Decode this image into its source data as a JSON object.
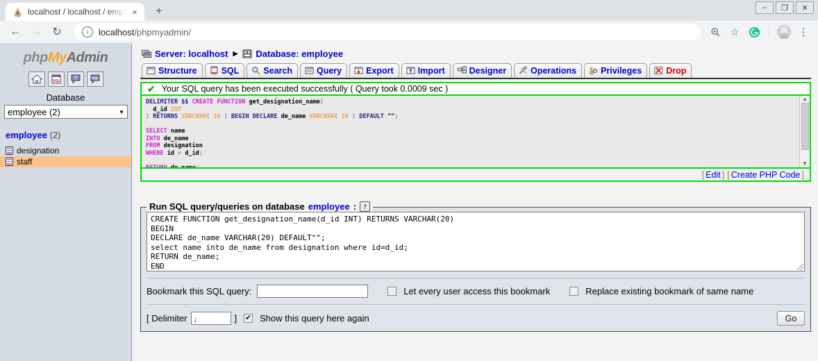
{
  "browser": {
    "tab": {
      "title": "localhost / localhost / employee |",
      "favicon": "phpmyadmin-favicon",
      "close": "×"
    },
    "newtab_label": "+",
    "window_controls": {
      "minimize": "–",
      "restore": "❐",
      "close": "✕"
    },
    "nav": {
      "back": "←",
      "forward": "→",
      "reload": "↻"
    },
    "omnibox": {
      "info": "i",
      "host": "localhost",
      "path": "/phpmyadmin/"
    },
    "toolbar_icons": {
      "zoom": "⌕",
      "bookmark": "☆",
      "grammarly": "G",
      "menu": "⋮"
    }
  },
  "sidebar": {
    "logo": {
      "php": "php",
      "my": "My",
      "admin": "Admin"
    },
    "quick_icons": [
      {
        "name": "home-icon",
        "glyph": "⌂"
      },
      {
        "name": "sql-doc-icon",
        "glyph": "SQL"
      },
      {
        "name": "help-bubble-icon",
        "glyph": "?"
      },
      {
        "name": "sql-bubble-icon",
        "glyph": "SQL"
      }
    ],
    "database_label": "Database",
    "database_select": {
      "value": "employee (2)",
      "arrow": "▼"
    },
    "db_heading": {
      "name": "employee",
      "count": "(2)"
    },
    "tables": [
      {
        "name": "designation",
        "selected": false
      },
      {
        "name": "staff",
        "selected": true
      }
    ]
  },
  "main": {
    "breadcrumb": {
      "server": "Server: localhost",
      "separator": "▶",
      "database": "Database: employee"
    },
    "tabs": [
      {
        "label": "Structure",
        "icon": "structure-icon"
      },
      {
        "label": "SQL",
        "icon": "sql-icon"
      },
      {
        "label": "Search",
        "icon": "search-icon"
      },
      {
        "label": "Query",
        "icon": "query-icon"
      },
      {
        "label": "Export",
        "icon": "export-icon"
      },
      {
        "label": "Import",
        "icon": "import-icon"
      },
      {
        "label": "Designer",
        "icon": "designer-icon"
      },
      {
        "label": "Operations",
        "icon": "operations-icon"
      },
      {
        "label": "Privileges",
        "icon": "privileges-icon"
      },
      {
        "label": "Drop",
        "icon": "drop-icon"
      }
    ],
    "success": {
      "check": "✔",
      "message": "Your SQL query has been executed successfully ( Query took 0.0009 sec )"
    },
    "code_preview": {
      "lines": [
        [
          [
            "DELIMITER",
            "kw"
          ],
          [
            " ",
            "id"
          ],
          [
            "$$",
            "kw"
          ],
          [
            " ",
            "id"
          ],
          [
            "CREATE FUNCTION",
            "fn"
          ],
          [
            " ",
            "id"
          ],
          [
            "get_designation_name",
            "id"
          ],
          [
            "(",
            "pn"
          ]
        ],
        [
          [
            "  ",
            "id"
          ],
          [
            "d_id",
            "id"
          ],
          [
            " ",
            "id"
          ],
          [
            "INT",
            "ty"
          ]
        ],
        [
          [
            ")",
            "pn"
          ],
          [
            " ",
            "id"
          ],
          [
            "RETURNS",
            "kw"
          ],
          [
            " ",
            "id"
          ],
          [
            "VARCHAR",
            "ty"
          ],
          [
            "( ",
            "pn"
          ],
          [
            "20",
            "ty"
          ],
          [
            " )",
            "pn"
          ],
          [
            " ",
            "id"
          ],
          [
            "BEGIN DECLARE",
            "kw"
          ],
          [
            " ",
            "id"
          ],
          [
            "de_name",
            "id"
          ],
          [
            " ",
            "id"
          ],
          [
            "VARCHAR",
            "ty"
          ],
          [
            "( ",
            "pn"
          ],
          [
            "20",
            "ty"
          ],
          [
            " )",
            "pn"
          ],
          [
            " ",
            "id"
          ],
          [
            "DEFAULT",
            "kw"
          ],
          [
            " ",
            "id"
          ],
          [
            "\"\"",
            "id"
          ],
          [
            ";",
            "pn"
          ]
        ],
        [
          [
            "",
            "id"
          ]
        ],
        [
          [
            "SELECT",
            "fn"
          ],
          [
            " ",
            "id"
          ],
          [
            "name",
            "id"
          ]
        ],
        [
          [
            "INTO",
            "fn"
          ],
          [
            " ",
            "id"
          ],
          [
            "de_name",
            "id"
          ]
        ],
        [
          [
            "FROM",
            "fn"
          ],
          [
            " ",
            "id"
          ],
          [
            "designation",
            "id"
          ]
        ],
        [
          [
            "WHERE",
            "fn"
          ],
          [
            " ",
            "id"
          ],
          [
            "id",
            "id"
          ],
          [
            " = ",
            "pn"
          ],
          [
            "d_id",
            "id"
          ],
          [
            ";",
            "pn"
          ]
        ],
        [
          [
            "",
            "id"
          ]
        ],
        [
          [
            "RETURN",
            "fn"
          ],
          [
            " ",
            "id"
          ],
          [
            "de_name",
            "id"
          ],
          [
            ";",
            "pn"
          ]
        ]
      ],
      "scrollbar": {
        "up": "▲",
        "down": "▼"
      },
      "links": {
        "open": "[",
        "edit": "Edit",
        "close": "]",
        "php": "Create PHP Code"
      }
    },
    "query_form": {
      "legend_prefix": "Run SQL query/queries on database",
      "legend_db": "employee",
      "legend_suffix": ":",
      "help_glyph": "?",
      "sql_value": "CREATE FUNCTION get_designation_name(d_id INT) RETURNS VARCHAR(20)\nBEGIN\nDECLARE de_name VARCHAR(20) DEFAULT\"\";\nselect name into de_name from designation where id=d_id;\nRETURN de_name;\nEND",
      "bookmark_label": "Bookmark this SQL query:",
      "bookmark_value": "",
      "let_every_user_label": "Let every user access this bookmark",
      "let_every_user_checked": false,
      "replace_label": "Replace existing bookmark of same name",
      "replace_checked": false,
      "delimiter_open": "[ Delimiter",
      "delimiter_value": ";",
      "delimiter_close": "]",
      "show_query_label": "Show this query here again",
      "show_query_checked": true,
      "check_glyph": "✔",
      "go_label": "Go"
    }
  }
}
